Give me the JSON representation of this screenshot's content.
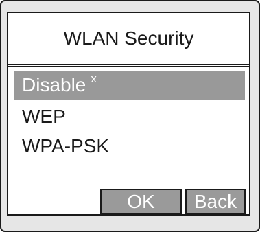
{
  "dialog": {
    "title": "WLAN Security",
    "options": [
      {
        "label": "Disable",
        "marker": "x",
        "selected": true
      },
      {
        "label": "WEP",
        "selected": false
      },
      {
        "label": "WPA-PSK",
        "selected": false
      }
    ],
    "buttons": {
      "ok_label": "OK",
      "back_label": "Back"
    }
  },
  "colors": {
    "screen_background": "#e6e6e6",
    "dialog_background": "#ffffff",
    "selection_highlight": "#999999",
    "button_fill": "#9a9a9a",
    "text": "#1a1a1a",
    "selected_text": "#ffffff"
  }
}
